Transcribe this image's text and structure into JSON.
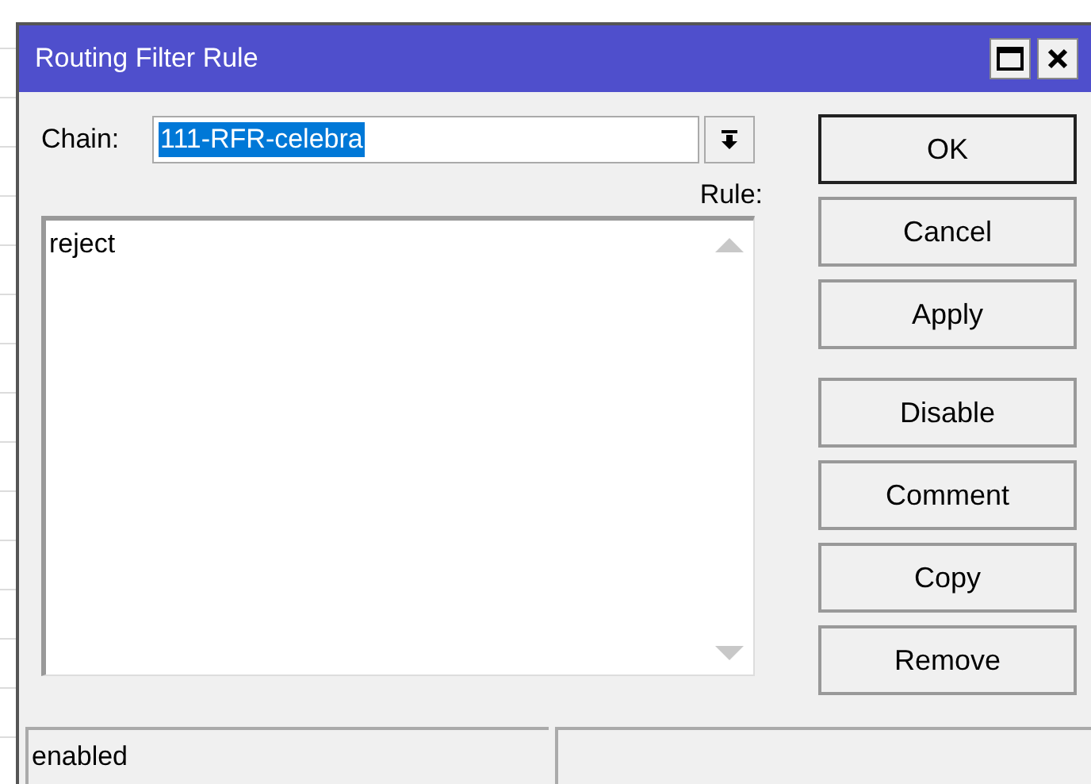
{
  "window": {
    "title": "Routing Filter Rule"
  },
  "chain": {
    "label": "Chain:",
    "value": "111-RFR-celebra",
    "selected": true
  },
  "rule": {
    "label": "Rule:",
    "text": "reject"
  },
  "buttons": [
    {
      "label": "OK",
      "default": true
    },
    {
      "label": "Cancel",
      "default": false
    },
    {
      "label": "Apply",
      "default": false
    },
    {
      "label": "Disable",
      "default": false
    },
    {
      "label": "Comment",
      "default": false
    },
    {
      "label": "Copy",
      "default": false
    },
    {
      "label": "Remove",
      "default": false
    }
  ],
  "status_bar": [
    "enabled"
  ]
}
